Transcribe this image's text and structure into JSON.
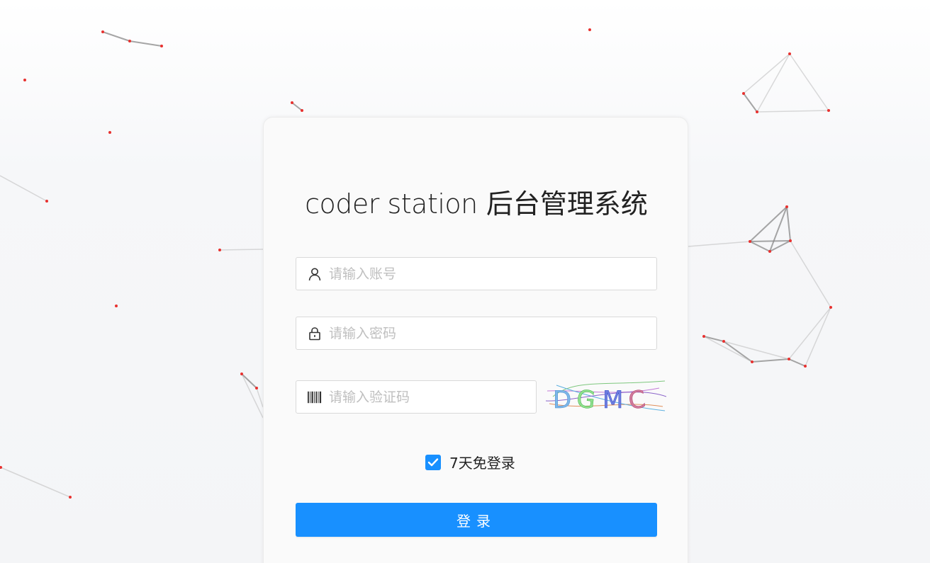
{
  "title": {
    "en": "coder station",
    "zh": "后台管理系统"
  },
  "form": {
    "account": {
      "placeholder": "请输入账号",
      "value": "",
      "icon": "user-icon"
    },
    "password": {
      "placeholder": "请输入密码",
      "value": "",
      "icon": "lock-icon"
    },
    "captcha": {
      "placeholder": "请输入验证码",
      "value": "",
      "icon": "barcode-icon",
      "image_text": "DGMC"
    },
    "remember": {
      "label": "7天免登录",
      "checked": true
    },
    "submit_label": "登录"
  },
  "colors": {
    "primary": "#1890ff",
    "particle": "#e8312f"
  }
}
